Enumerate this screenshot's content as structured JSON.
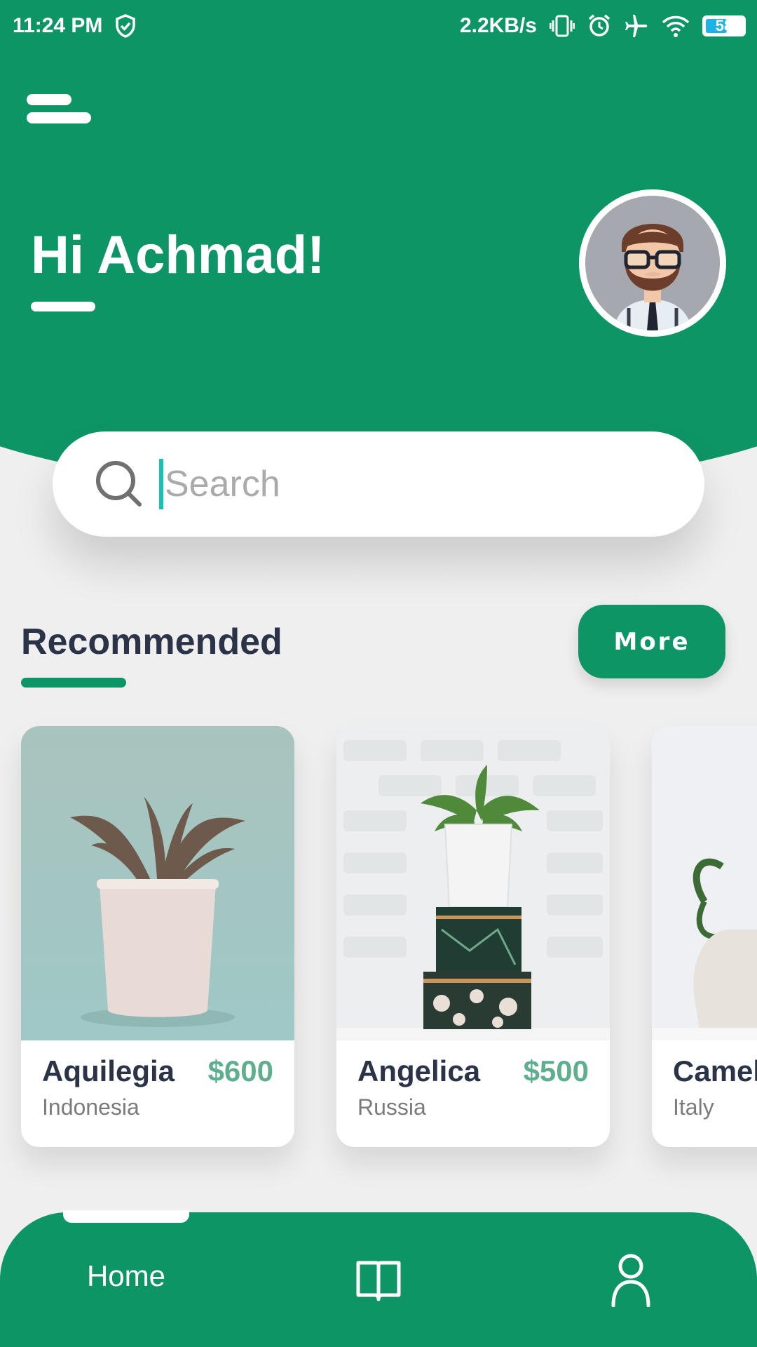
{
  "status_bar": {
    "time": "11:24 PM",
    "speed": "2.2KB/s",
    "battery": "58",
    "icons": [
      "shield-check-icon",
      "vibrate-icon",
      "alarm-icon",
      "airplane-icon",
      "wifi-icon",
      "battery-icon"
    ]
  },
  "header": {
    "greeting": "Hi Achmad!",
    "menu_icon": "menu-icon",
    "avatar": "avatar"
  },
  "search": {
    "placeholder": "Search",
    "value": ""
  },
  "section": {
    "title": "Recommended",
    "more_label": "More"
  },
  "cards": [
    {
      "name": "Aquilegia",
      "price": "$600",
      "country": "Indonesia"
    },
    {
      "name": "Angelica",
      "price": "$500",
      "country": "Russia"
    },
    {
      "name": "Camel",
      "country": "Italy"
    }
  ],
  "bottom_nav": {
    "home_label": "Home",
    "icons": [
      "book-icon",
      "user-icon"
    ]
  },
  "colors": {
    "primary": "#0e9566",
    "price": "#5fae90",
    "title": "#2a3348",
    "caret": "#17c1b3"
  }
}
